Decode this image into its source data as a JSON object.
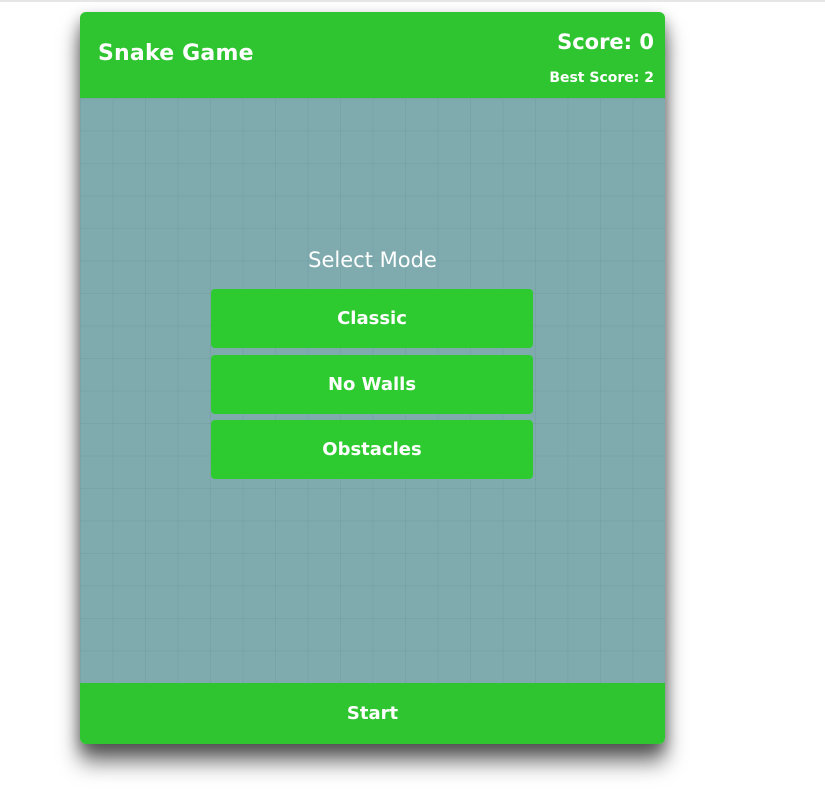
{
  "header": {
    "title": "Snake Game",
    "score_label": "Score: 0",
    "best_score_label": "Best Score: 2"
  },
  "menu": {
    "title": "Select Mode",
    "modes": [
      {
        "label": "Classic"
      },
      {
        "label": "No Walls"
      },
      {
        "label": "Obstacles"
      }
    ]
  },
  "footer": {
    "start_label": "Start"
  },
  "colors": {
    "header_green": "#2ec530",
    "button_green": "#2ecb30",
    "board_teal": "#7fabaf",
    "text_white": "#ffffff"
  }
}
